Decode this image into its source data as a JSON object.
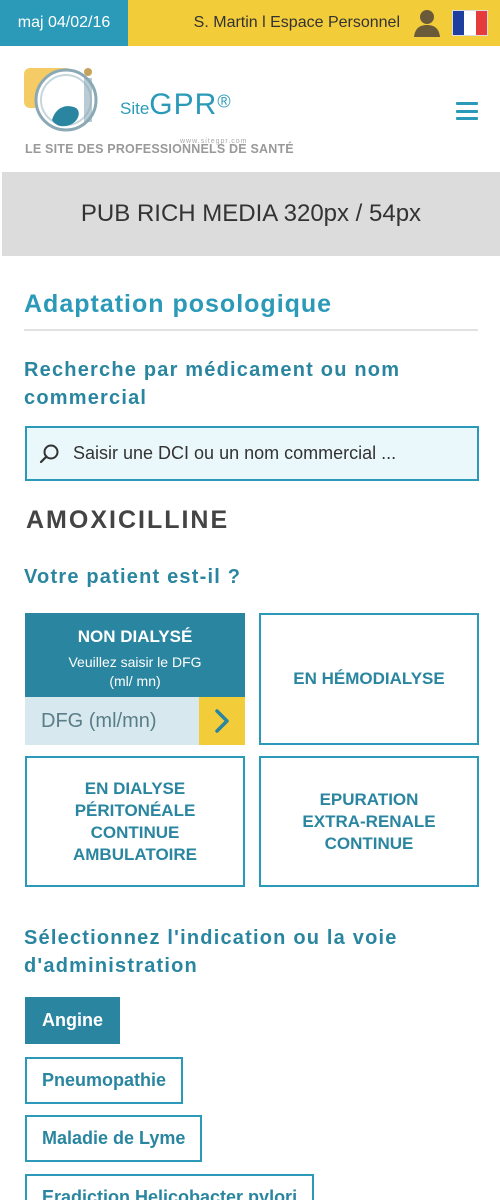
{
  "topbar": {
    "update_date": "maj 04/02/16",
    "user_link": "S. Martin l Espace Personnel",
    "user_icon": "user-icon",
    "flag": "french-flag-icon",
    "colors": {
      "blue": "#2a9ab8",
      "yellow": "#f3cc3a"
    }
  },
  "header": {
    "brand_prefix": "Site",
    "brand_name": "GPR",
    "brand_mark": "®",
    "www": "www.sitegpr.com",
    "tagline": "LE SITE DES PROFESSIONNELS DE SANTÉ",
    "menu_icon": "hamburger-menu-icon"
  },
  "ad": {
    "label": "PUB RICH MEDIA 320px / 54px"
  },
  "main": {
    "title": "Adaptation posologique",
    "search_heading": "Recherche par médicament ou nom commercial",
    "search_placeholder": "Saisir une DCI ou un nom commercial ...",
    "search_icon": "search-icon",
    "drug_name": "AMOXICILLINE",
    "patient_question": "Votre patient est-il ?",
    "patient_options": {
      "non_dialyse": {
        "label": "NON DIALYSÉ",
        "hint": "Veuillez saisir le DFG (ml/ mn)",
        "input_placeholder": "DFG (ml/mn)",
        "go_icon": "chevron-right-icon"
      },
      "hemodialyse": "EN HÉMODIALYSE",
      "dialyse_peritoneale": "EN DIALYSE PÉRITONÉALE CONTINUE AMBULATOIRE",
      "epuration": "EPURATION EXTRA-RENALE CONTINUE"
    },
    "indication_heading": "Sélectionnez l'indication ou la voie d'administration",
    "indications": [
      {
        "label": "Angine",
        "selected": true
      },
      {
        "label": "Pneumopathie",
        "selected": false
      },
      {
        "label": "Maladie de Lyme",
        "selected": false
      },
      {
        "label": "Eradiction Helicobacter pylori",
        "selected": false
      }
    ]
  }
}
